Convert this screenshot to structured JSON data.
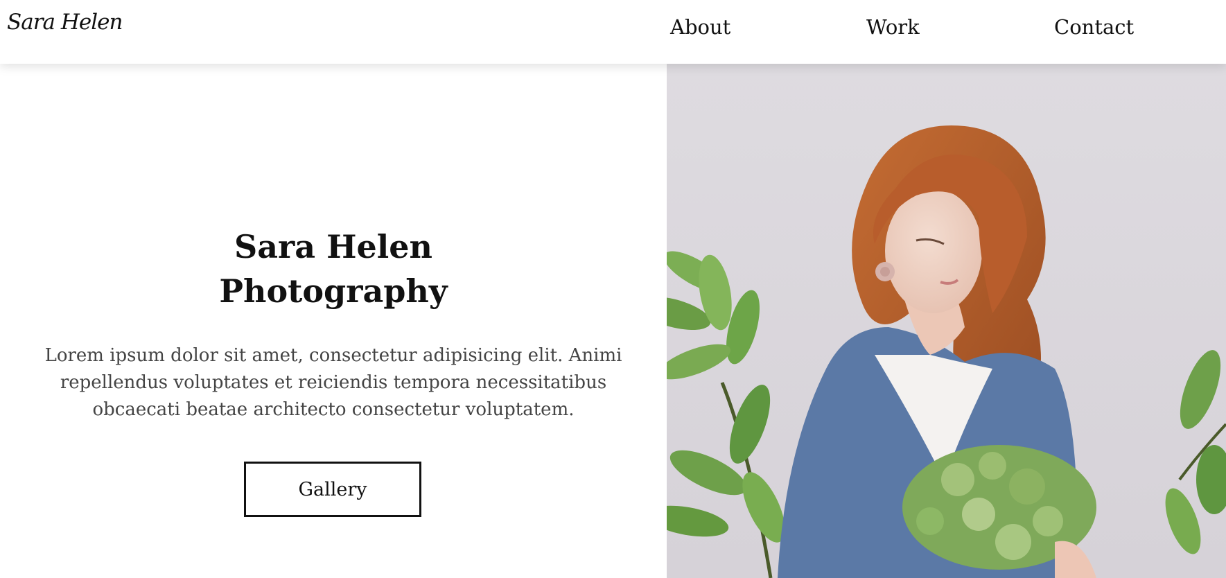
{
  "header": {
    "logo": "Sara Helen",
    "nav": [
      {
        "label": "About"
      },
      {
        "label": "Work"
      },
      {
        "label": "Contact"
      }
    ]
  },
  "hero": {
    "title_line1": "Sara Helen",
    "title_line2": "Photography",
    "text": "Lorem ipsum dolor sit amet, consectetur adipisicing elit. Animi repellendus voluptates et reiciendis tempora necessitatibus obcaecati beatae architecto consectetur voluptatem.",
    "button_label": "Gallery"
  },
  "photo": {
    "subject": "woman-with-flowers-photo",
    "colors": {
      "background": "#dcd9de",
      "hair": "#b8612f",
      "sweater": "#5b79a6",
      "leaf": "#6ea04a"
    }
  }
}
